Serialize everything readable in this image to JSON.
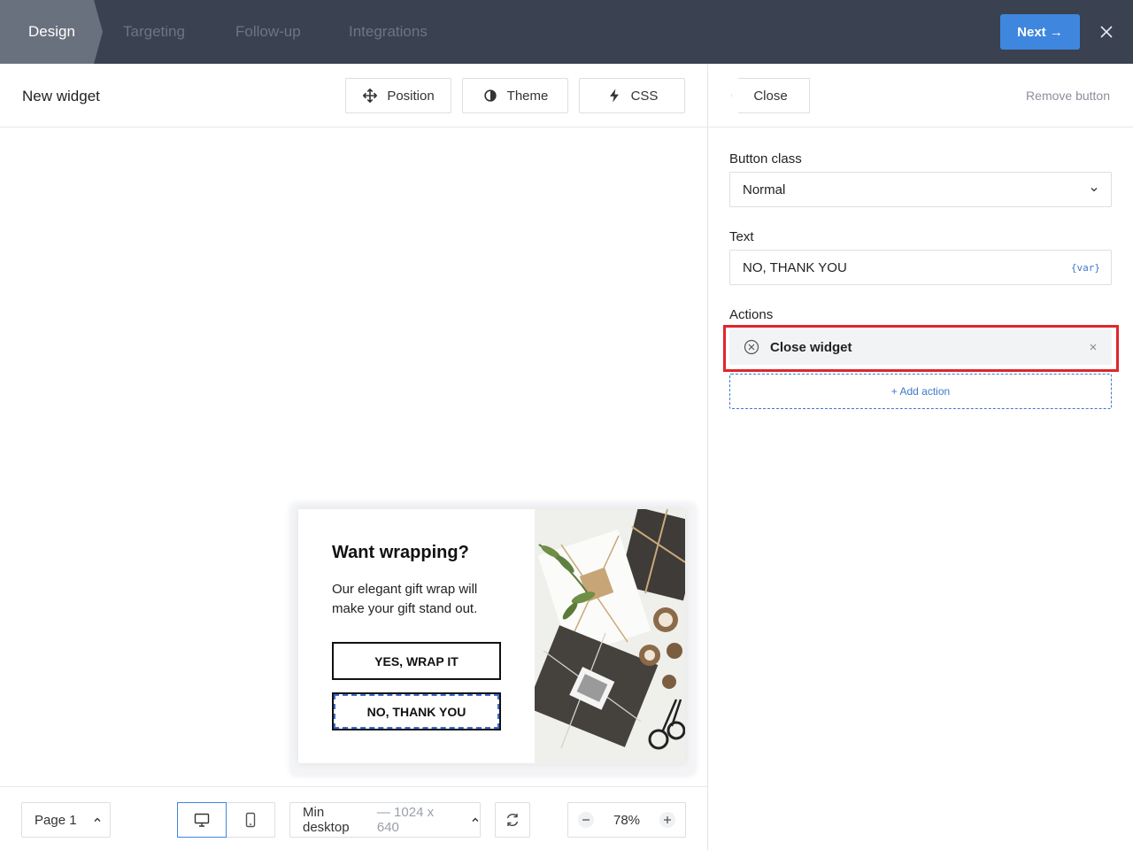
{
  "steps": [
    "Design",
    "Targeting",
    "Follow-up",
    "Integrations"
  ],
  "next_label": "Next →",
  "editor": {
    "widget_name": "New widget",
    "tools": {
      "position": "Position",
      "theme": "Theme",
      "css": "CSS"
    }
  },
  "popup": {
    "title": "Want wrapping?",
    "body": "Our elegant gift wrap will make your gift stand out.",
    "yes_label": "YES, WRAP IT",
    "no_label": "NO, THANK YOU"
  },
  "bottom": {
    "page": "Page 1",
    "viewport_name": "Min desktop",
    "viewport_size": "— 1024 x 640",
    "zoom": "78%"
  },
  "panel": {
    "back_label": "Close",
    "remove_label": "Remove button",
    "button_class_label": "Button class",
    "button_class_value": "Normal",
    "text_label": "Text",
    "text_value": "NO, THANK YOU",
    "var_tag": "{var}",
    "actions_label": "Actions",
    "action_item": "Close widget",
    "add_action": "+ Add action"
  },
  "colors": {
    "topbar": "#3a4150",
    "accent": "#3f86de",
    "highlight": "#e0262b"
  }
}
